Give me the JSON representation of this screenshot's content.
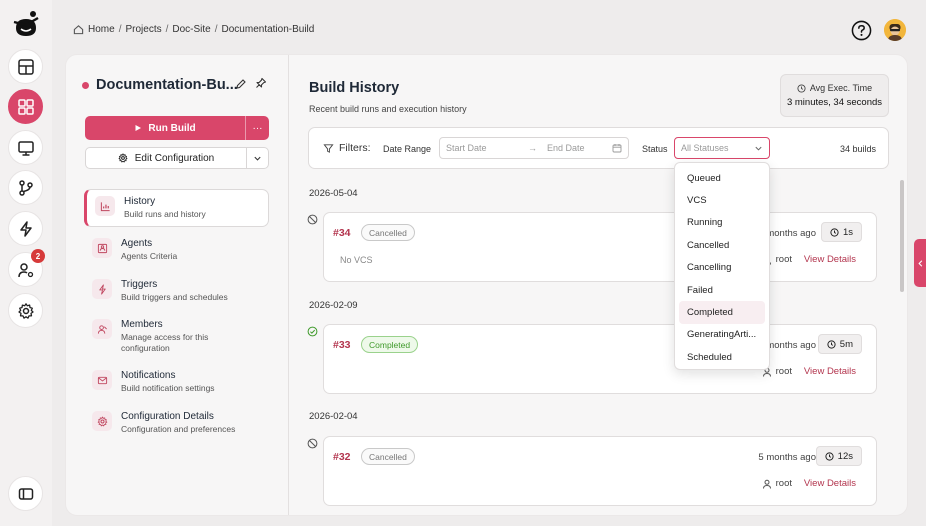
{
  "breadcrumb": [
    "Home",
    "Projects",
    "Doc-Site",
    "Documentation-Build"
  ],
  "nav_badge": "2",
  "config": {
    "title": "Documentation-Bu...",
    "run_label": "Run Build",
    "more_label": "···",
    "edit_label": "Edit Configuration"
  },
  "nav": [
    {
      "label": "History",
      "sub": "Build runs and history"
    },
    {
      "label": "Agents",
      "sub": "Agents Criteria"
    },
    {
      "label": "Triggers",
      "sub": "Build triggers and schedules"
    },
    {
      "label": "Members",
      "sub": "Manage access for this configuration"
    },
    {
      "label": "Notifications",
      "sub": "Build notification settings"
    },
    {
      "label": "Configuration Details",
      "sub": "Configuration and preferences"
    }
  ],
  "history": {
    "title": "Build History",
    "subtitle": "Recent build runs and execution history",
    "avg_label": "Avg Exec. Time",
    "avg_value": "3 minutes, 34 seconds"
  },
  "filters": {
    "label": "Filters:",
    "date_range_label": "Date Range",
    "start_placeholder": "Start Date",
    "arrow": "→",
    "end_placeholder": "End Date",
    "status_label": "Status",
    "status_value": "All Statuses",
    "count": "34 builds"
  },
  "runs": [
    {
      "date": "2026-05-04",
      "id": "#34",
      "status": "Cancelled",
      "vcs": "No VCS",
      "ago": "2 months ago",
      "duration": "1s",
      "user": "root",
      "details": "View Details"
    },
    {
      "date": "2026-02-09",
      "id": "#33",
      "status": "Completed",
      "vcs": "",
      "ago": "4 months ago",
      "duration": "5m",
      "user": "root",
      "details": "View Details"
    },
    {
      "date": "2026-02-04",
      "id": "#32",
      "status": "Cancelled",
      "vcs": "",
      "ago": "5 months ago",
      "duration": "12s",
      "user": "root",
      "details": "View Details"
    }
  ],
  "status_options": [
    "Queued",
    "VCS",
    "Running",
    "Cancelled",
    "Cancelling",
    "Failed",
    "Completed",
    "GeneratingArti...",
    "Scheduled"
  ],
  "colors": {
    "accent": "#d9466a",
    "success": "#3f9a2b",
    "link": "#b3354e"
  }
}
